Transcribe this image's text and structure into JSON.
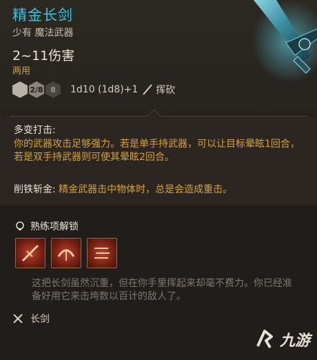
{
  "item": {
    "name": "精金长剑",
    "rarity_type": "少有 魔法武器",
    "damage": "2~11伤害",
    "handedness": "两用",
    "dice": [
      "2/8",
      "8"
    ],
    "damage_formula": "1d10 (1d8)+1",
    "damage_type": "挥砍"
  },
  "properties": {
    "special_title": "多变打击:",
    "special_desc": "你的武器攻击足够强力。若是单手持武器，可以让目标晕眩1回合，若是双手持武器则可使其晕眩2回合。",
    "sunder_label": "削铁斩金:",
    "sunder_desc": " 精金武器击中物体时，总是会造成重击。"
  },
  "mastery": {
    "title": "熟练项解锁",
    "skills": [
      "skill-1",
      "skill-2",
      "skill-3"
    ]
  },
  "flavor_text": "这把长剑虽然沉重，但在你手里挥起来却毫不费力。你已经准备好用它来击垮数以百计的敌人了。",
  "weapon_type": "长剑",
  "watermark": "九游",
  "colors": {
    "title": "#3fc2df",
    "accent_gold": "#d8a23a",
    "skill_red": "#b5432d"
  }
}
